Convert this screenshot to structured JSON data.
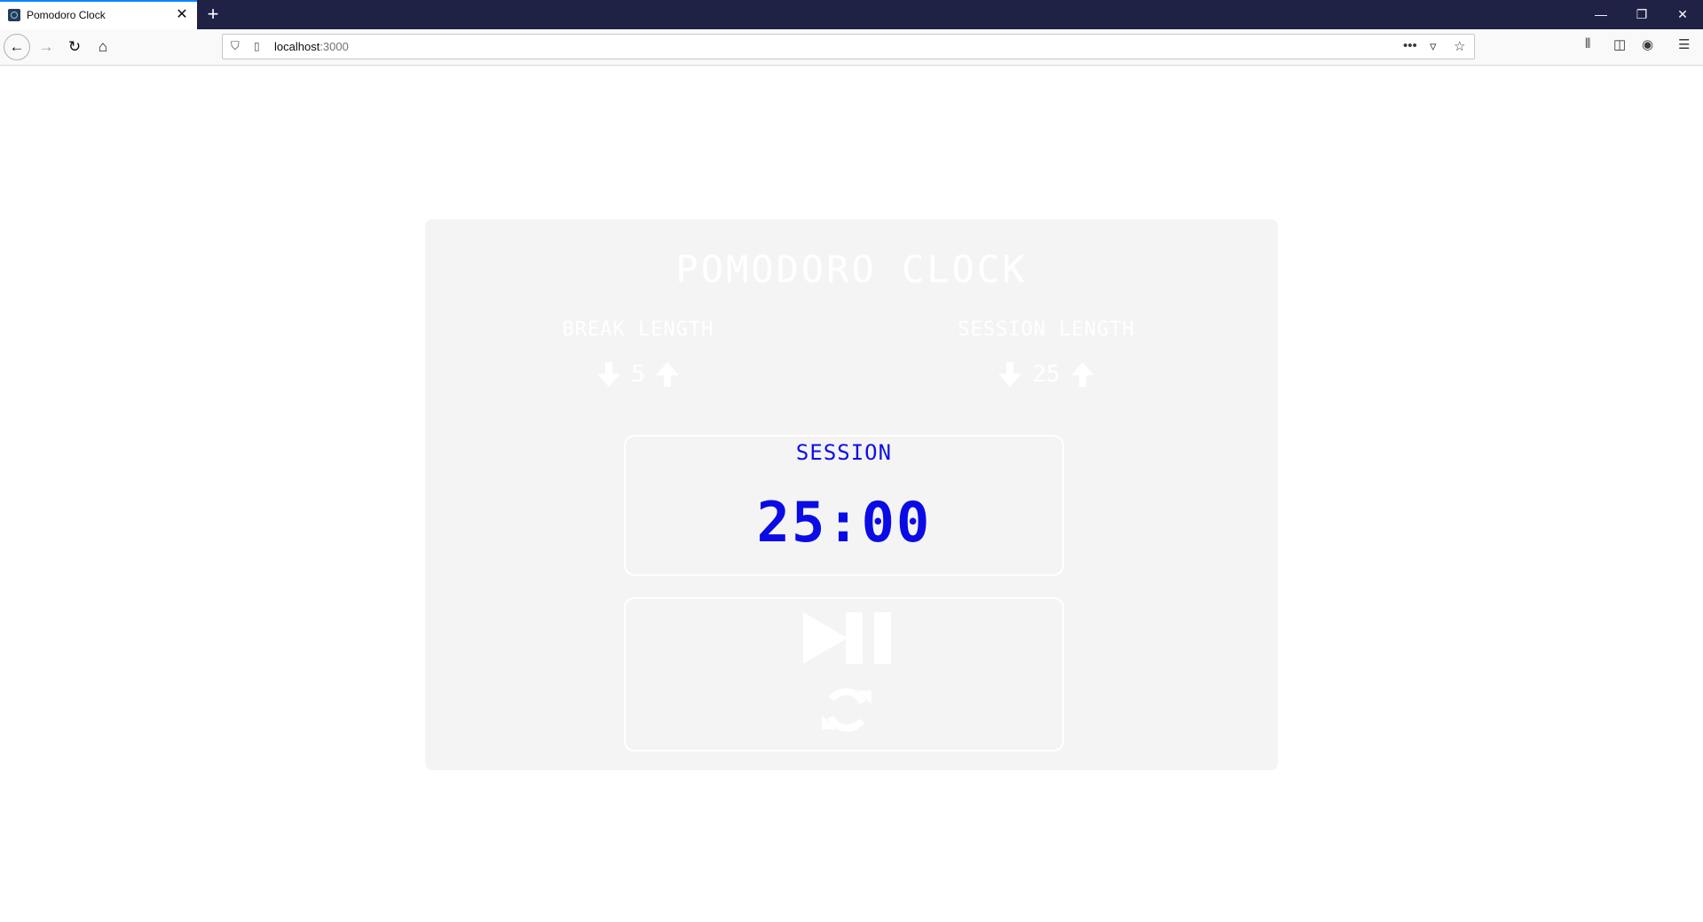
{
  "browser": {
    "tab_title": "Pomodoro Clock",
    "url_host": "localhost",
    "url_port": ":3000",
    "icons": [
      "back-icon",
      "forward-icon",
      "reload-icon",
      "home-icon",
      "shield-icon",
      "page-icon",
      "more-icon",
      "pocket-icon",
      "bookmark-star-icon",
      "library-icon",
      "sidebar-icon",
      "account-icon",
      "menu-icon"
    ]
  },
  "app": {
    "title": "Pomodoro Clock",
    "break": {
      "label": "Break Length",
      "value": "5"
    },
    "session": {
      "label": "Session Length",
      "value": "25"
    },
    "timer": {
      "label": "Session",
      "time": "25:00"
    },
    "controls": [
      "play-pause-icon",
      "reset-icon"
    ],
    "colors": {
      "card": "#f4f4f4",
      "text": "#ffffff",
      "timer": "#0b0be6"
    }
  }
}
